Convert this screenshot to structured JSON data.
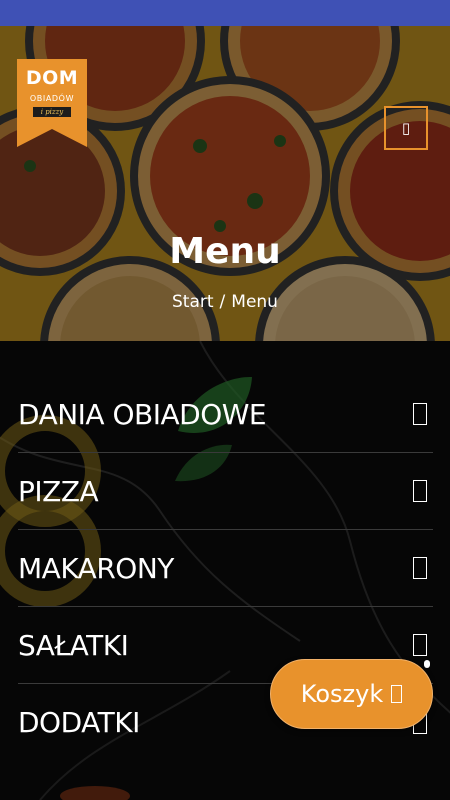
{
  "brand": {
    "name": "DOM",
    "subtitle": "OBIADÓW",
    "ribbon": "i pizzy",
    "accent_color": "#e8922c",
    "logo_text_color": "#ffffff",
    "status_bar_color": "#3f51b5"
  },
  "header": {
    "menu_toggle_icon": "hamburger-menu-icon",
    "menu_toggle_glyph": "▯",
    "title": "Menu",
    "breadcrumb": {
      "home": "Start",
      "separator": "/",
      "current": "Menu"
    }
  },
  "categories": [
    {
      "label": "DANIA OBIADOWE",
      "icon": "chevron-right-icon",
      "glyph": "▯"
    },
    {
      "label": "PIZZA",
      "icon": "chevron-right-icon",
      "glyph": "▯"
    },
    {
      "label": "MAKARONY",
      "icon": "chevron-right-icon",
      "glyph": "▯"
    },
    {
      "label": "SAŁATKI",
      "icon": "chevron-right-icon",
      "glyph": "▯"
    },
    {
      "label": "DODATKI",
      "icon": "chevron-right-icon",
      "glyph": "▯"
    }
  ],
  "cart": {
    "label": "Koszyk",
    "icon": "cart-icon",
    "glyph": "▯",
    "color": "#e8922c"
  }
}
